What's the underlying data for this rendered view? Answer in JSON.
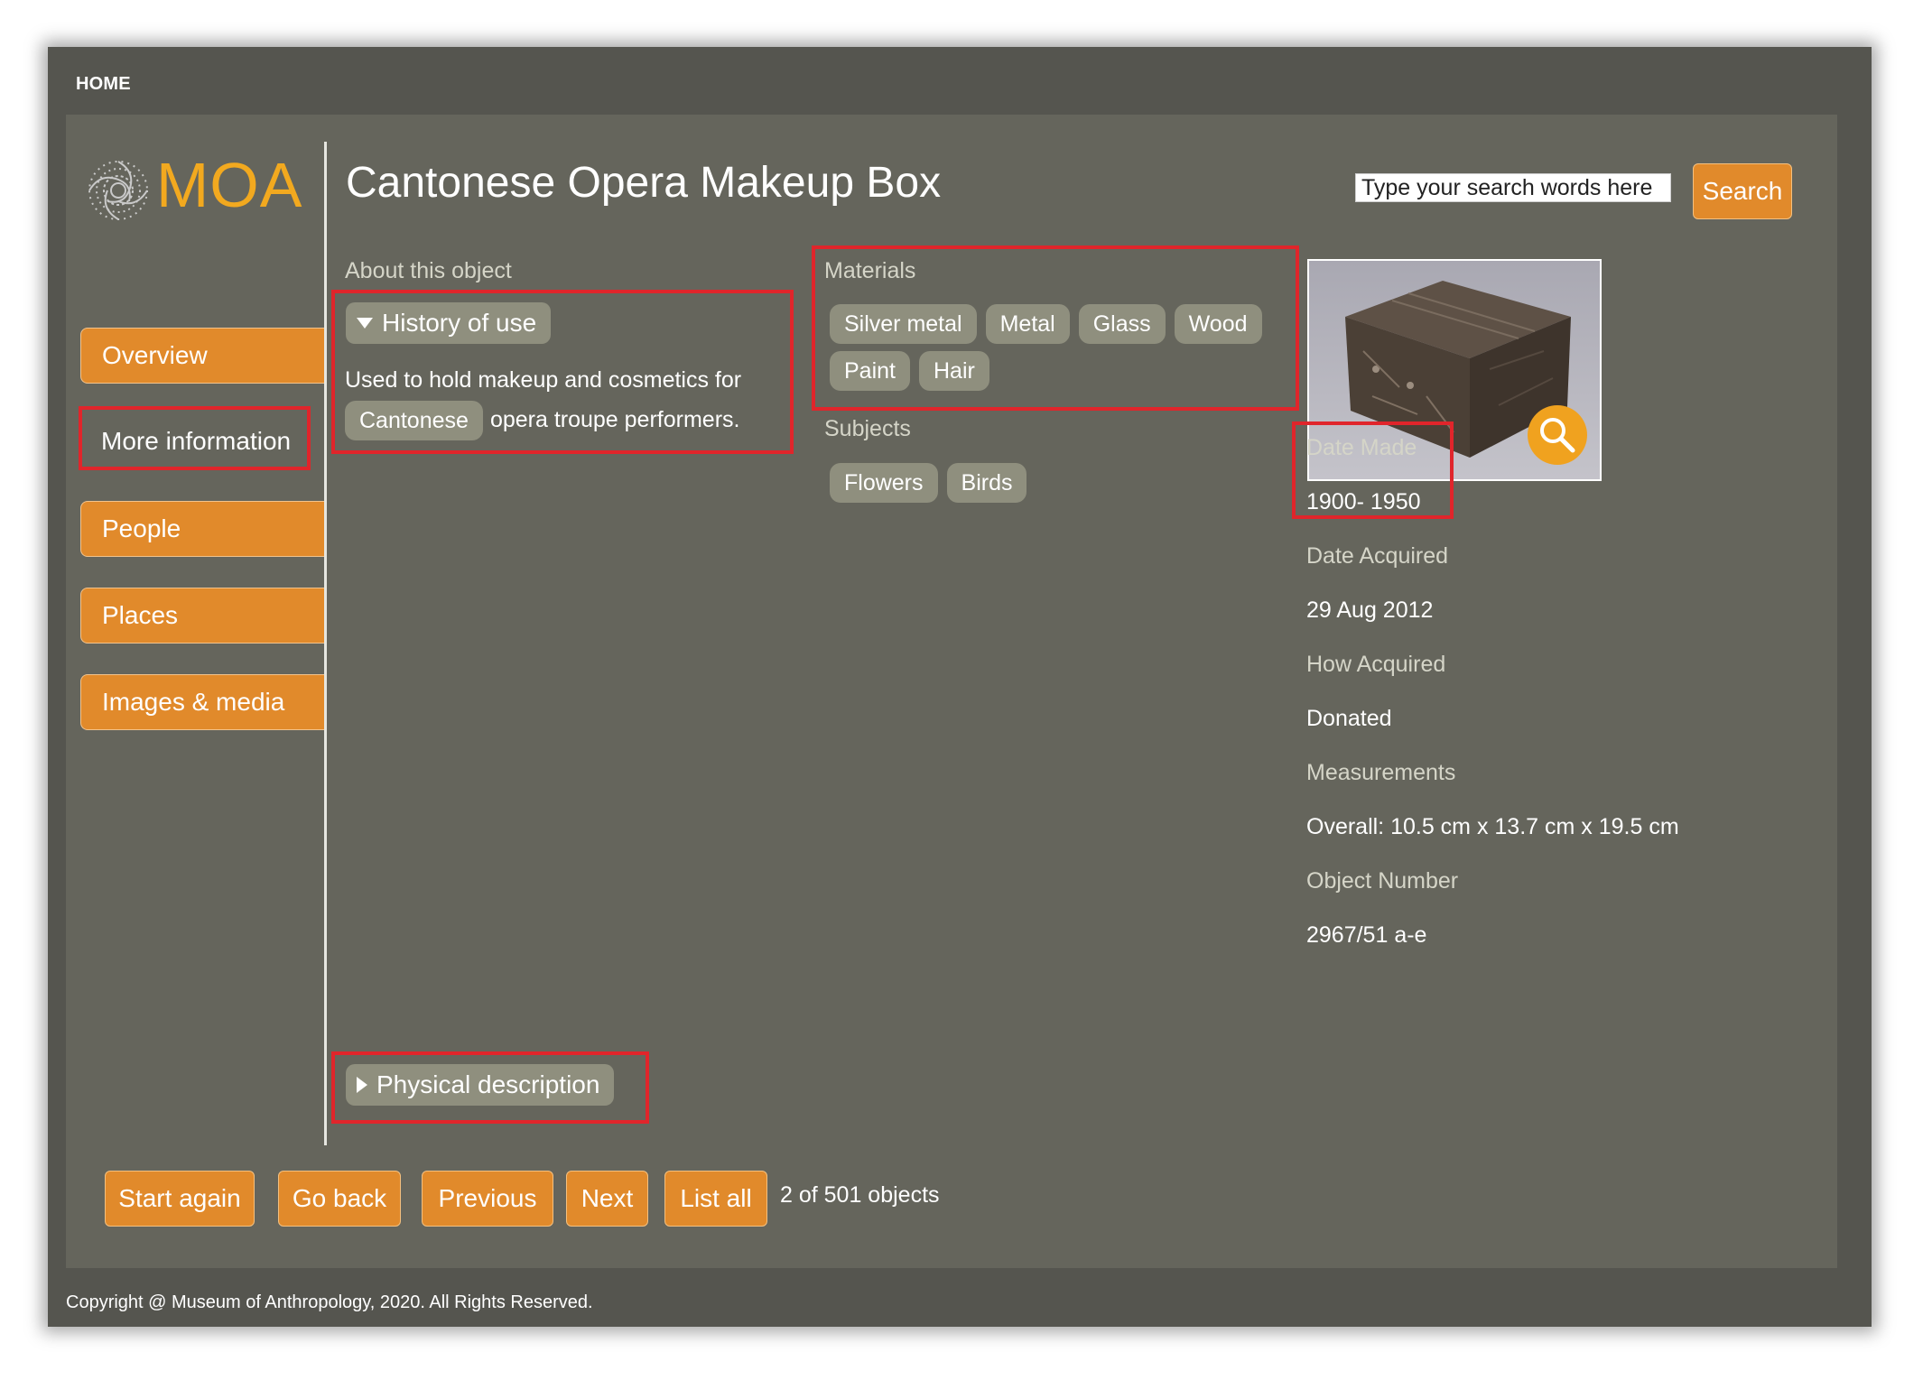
{
  "nav": {
    "home_label": "HOME"
  },
  "logo": {
    "text": "MOA"
  },
  "page": {
    "title": "Cantonese Opera Makeup Box"
  },
  "search": {
    "placeholder": "Type your search words here",
    "button_label": "Search"
  },
  "sidebar": {
    "items": [
      {
        "label": "Overview",
        "active": false
      },
      {
        "label": "More information",
        "active": true
      },
      {
        "label": "People",
        "active": false
      },
      {
        "label": "Places",
        "active": false
      },
      {
        "label": "Images & media",
        "active": false
      }
    ]
  },
  "about": {
    "label": "About this object",
    "history": {
      "toggle_label": "History of use",
      "text_before": "Used to hold makeup and cosmetics for",
      "link_tag": "Cantonese",
      "text_after": "opera troupe performers."
    },
    "physical_toggle_label": "Physical description"
  },
  "materials": {
    "label": "Materials",
    "tags": [
      "Silver metal",
      "Metal",
      "Glass",
      "Wood",
      "Paint",
      "Hair"
    ]
  },
  "subjects": {
    "label": "Subjects",
    "tags": [
      "Flowers",
      "Birds"
    ]
  },
  "details": {
    "date_made_label": "Date Made",
    "date_made": "1900- 1950",
    "date_acquired_label": "Date Acquired",
    "date_acquired": "29 Aug 2012",
    "how_acquired_label": "How Acquired",
    "how_acquired": "Donated",
    "measurements_label": "Measurements",
    "measurements": "Overall: 10.5 cm x 13.7 cm x 19.5 cm",
    "object_number_label": "Object Number",
    "object_number": "2967/51 a-e"
  },
  "bottom_nav": {
    "start_again": "Start again",
    "go_back": "Go back",
    "previous": "Previous",
    "next": "Next",
    "list_all": "List all",
    "count_text": "2 of 501 objects"
  },
  "footer": {
    "copyright": "Copyright @ Museum of Anthropology, 2020. All Rights Reserved."
  },
  "colors": {
    "accent": "#e18a2b",
    "logo": "#f2a91f",
    "panel": "#65655c",
    "frame": "#55554f",
    "tag": "#8f8f7e",
    "highlight": "#e0252b"
  }
}
